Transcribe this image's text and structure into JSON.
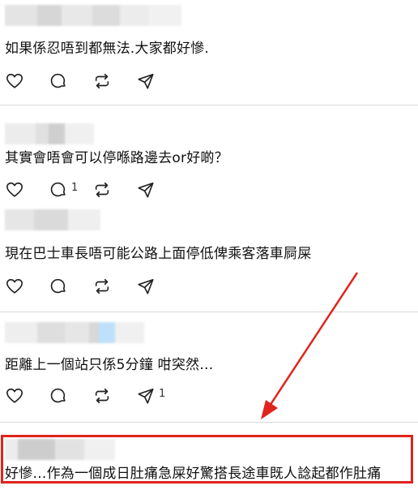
{
  "accent_color": "#e0241c",
  "icons": [
    "heart-icon",
    "comment-icon",
    "repost-icon",
    "share-icon"
  ],
  "posts": [
    {
      "text": "如果係忍唔到都無法.大家都好慘.",
      "comment_count": "",
      "share_count": ""
    },
    {
      "text": "其實會唔會可以停喺路邊去or好啲？",
      "comment_count": "1",
      "share_count": ""
    },
    {
      "text": "現在巴士車長唔可能公路上面停低俾乘客落車屙屎",
      "comment_count": "",
      "share_count": ""
    },
    {
      "text": "距離上一個站只係5分鐘 咁突然…",
      "comment_count": "",
      "share_count": "1"
    },
    {
      "text": "好慘…作為一個成日肚痛急屎好驚搭長途車既人諗起都作肚痛",
      "comment_count": "",
      "share_count": ""
    }
  ]
}
